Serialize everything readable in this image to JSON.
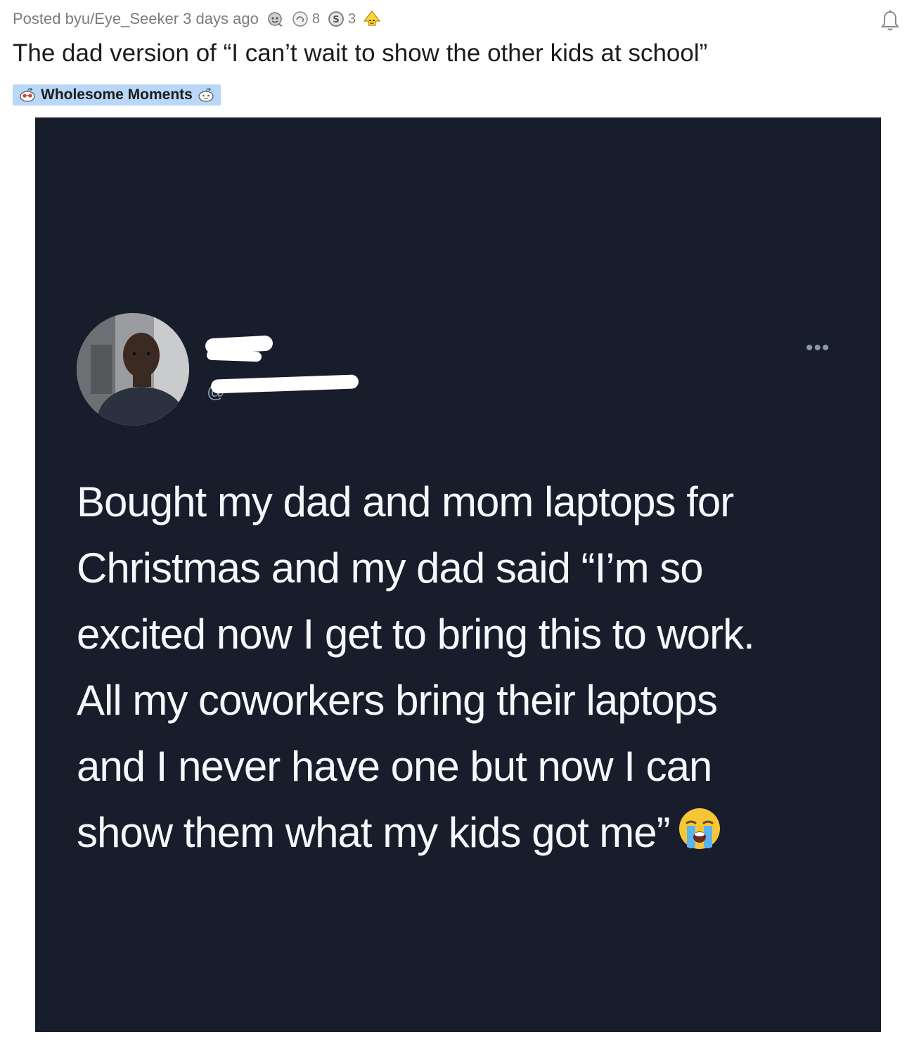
{
  "post": {
    "posted_by_prefix": "Posted by ",
    "username": "u/Eye_Seeker",
    "time_ago": "3 days ago",
    "awards": [
      {
        "icon": "wholesome-award-icon",
        "count": ""
      },
      {
        "icon": "helpful-award-icon",
        "count": "8"
      },
      {
        "icon": "silver-coin-award-icon",
        "count": "3"
      },
      {
        "icon": "rocket-like-award-icon",
        "count": ""
      }
    ],
    "title": "The dad version of “I can’t wait to show the other kids at school”",
    "flair": {
      "label": "Wholesome Moments",
      "background": "#b9d7f7"
    }
  },
  "tweet": {
    "background": "#171d2b",
    "handle_prefix": "@",
    "more_label": "•••",
    "text_lines": [
      "Bought my dad and mom  laptops for",
      "Christmas and my dad said “I’m so",
      "excited now I get to bring this to work.",
      "All my coworkers bring their laptops",
      "and I never have one but now I can",
      "show them what my kids got me”"
    ],
    "emoji": "loudly-crying-face"
  }
}
